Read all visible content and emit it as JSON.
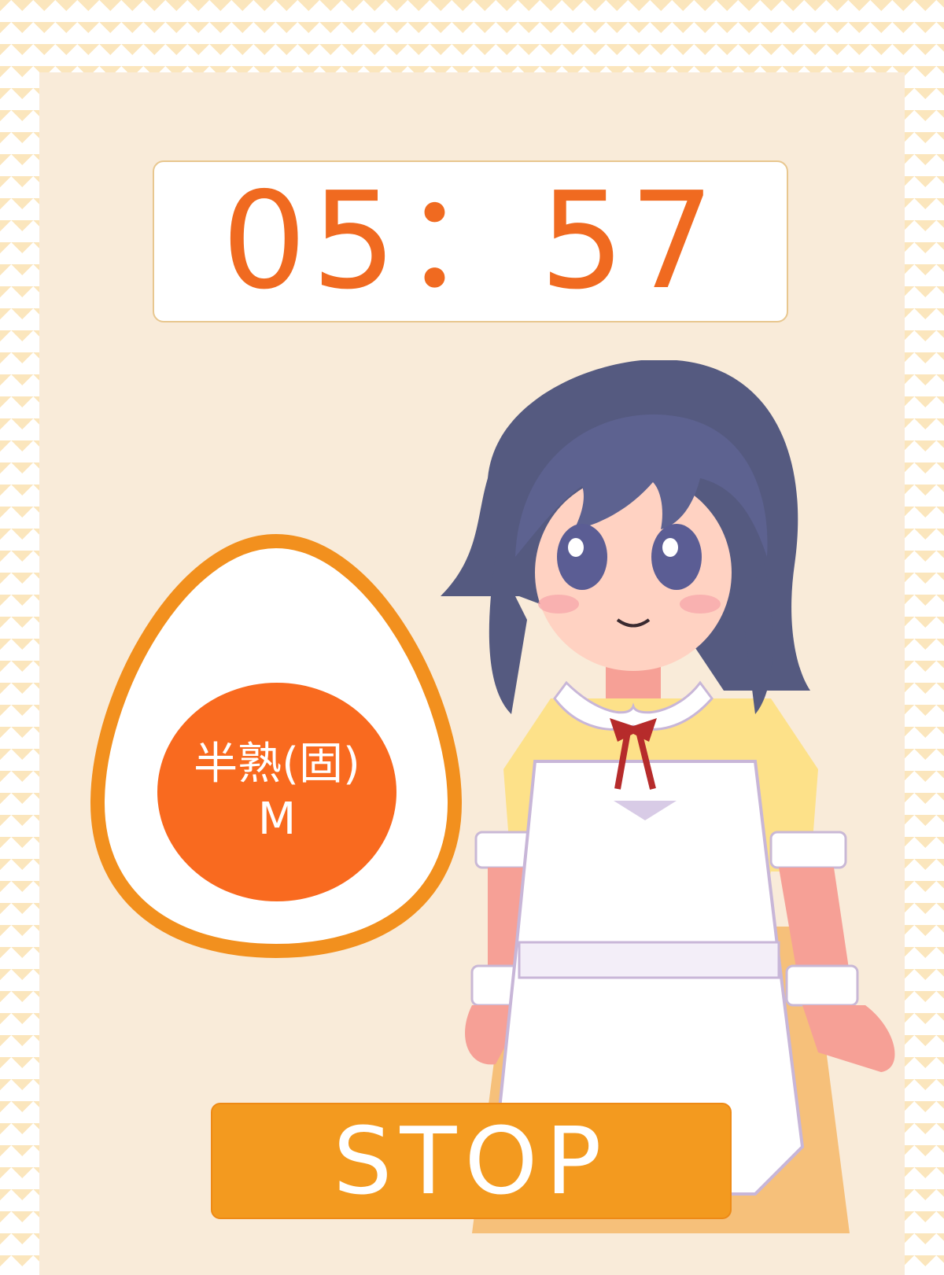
{
  "timer": {
    "display": "05：57"
  },
  "egg": {
    "type_label": "半熟(固)",
    "size_label": "M"
  },
  "controls": {
    "stop_label": "STOP"
  },
  "colors": {
    "accent_orange": "#f96a1f",
    "button_orange": "#f39a1f",
    "panel_bg": "#f9ebd9",
    "pattern": "#fbe6bd"
  },
  "icons": {
    "character": "maid-character-illustration",
    "egg": "egg-outline-icon"
  }
}
